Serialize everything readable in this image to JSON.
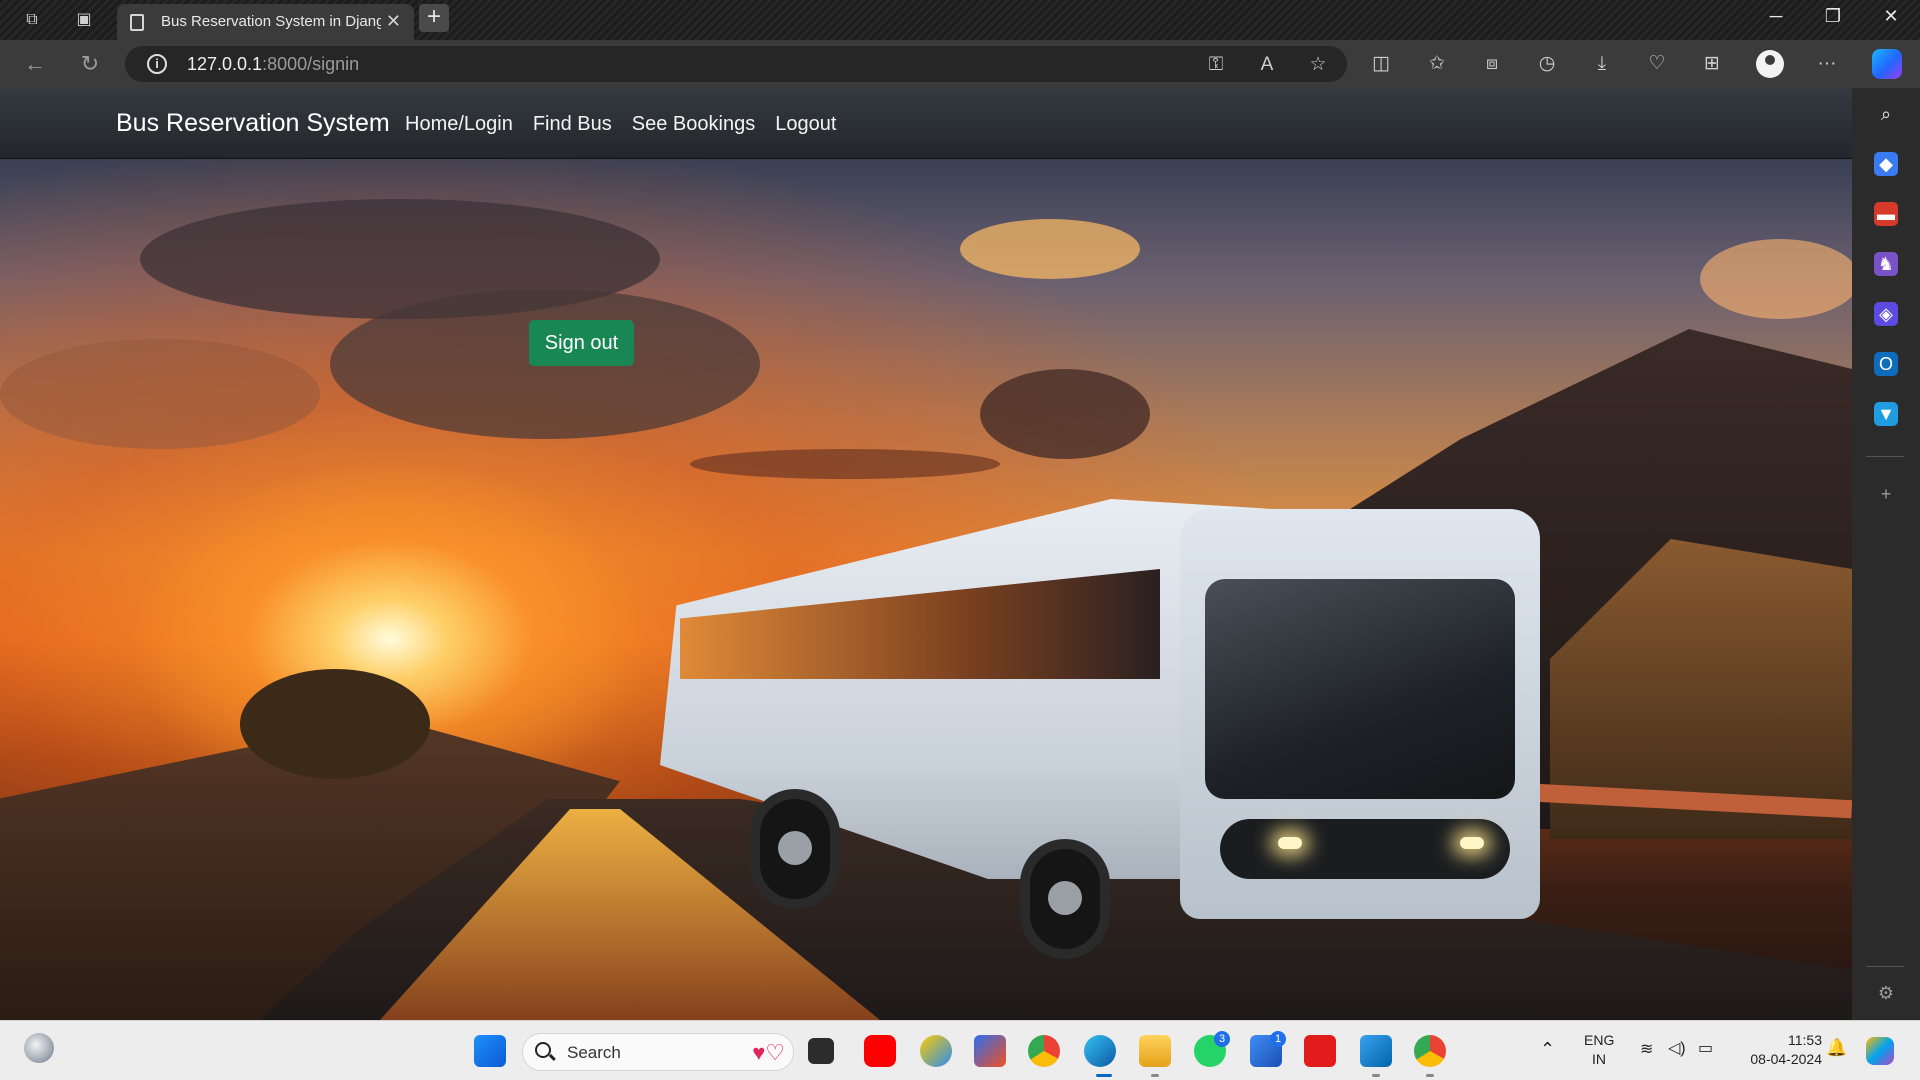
{
  "browser": {
    "tab": {
      "title": "Bus Reservation System in Djang"
    },
    "address": {
      "host": "127.0.0.1",
      "path": ":8000/signin"
    },
    "controls": {
      "back_icon": "←",
      "refresh_icon": "↻",
      "new_tab_icon": "+",
      "close_tab_icon": "✕",
      "minimize_icon": "─",
      "maximize_icon": "❐",
      "close_window_icon": "✕",
      "more_icon": "···"
    }
  },
  "site": {
    "brand": "Bus Reservation System",
    "nav": [
      {
        "label": "Home/Login"
      },
      {
        "label": "Find Bus"
      },
      {
        "label": "See Bookings"
      },
      {
        "label": "Logout"
      }
    ],
    "signout_button": "Sign out"
  },
  "taskbar": {
    "search_placeholder": "Search",
    "language": {
      "line1": "ENG",
      "line2": "IN"
    },
    "clock": {
      "time": "11:53",
      "date": "08-04-2024"
    },
    "badges": {
      "whatsapp": "3",
      "phone_link": "1"
    }
  },
  "colors": {
    "navbar": "#343a40",
    "signout_button": "#198754",
    "browser_toolbar": "#3b3b3b",
    "taskbar": "#ededed"
  }
}
